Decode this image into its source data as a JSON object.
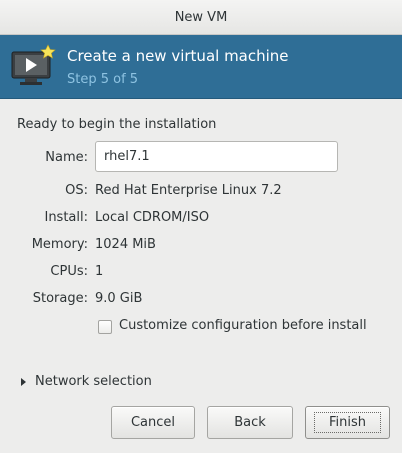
{
  "window": {
    "title": "New VM"
  },
  "banner": {
    "title": "Create a new virtual machine",
    "step": "Step 5 of 5",
    "icon": "vm-wizard-icon"
  },
  "summary": {
    "heading": "Ready to begin the installation",
    "name_label": "Name:",
    "name_value": "rhel7.1",
    "os_label": "OS:",
    "os_value": "Red Hat Enterprise Linux 7.2",
    "install_label": "Install:",
    "install_value": "Local CDROM/ISO",
    "memory_label": "Memory:",
    "memory_value": "1024 MiB",
    "cpus_label": "CPUs:",
    "cpus_value": "1",
    "storage_label": "Storage:",
    "storage_value": "9.0 GiB"
  },
  "customize": {
    "label": "Customize configuration before install",
    "checked": false
  },
  "network": {
    "label": "Network selection",
    "expanded": false
  },
  "buttons": {
    "cancel": "Cancel",
    "back": "Back",
    "finish": "Finish"
  },
  "colors": {
    "banner_bg": "#2f6e96",
    "banner_step": "#8ec3e2"
  }
}
